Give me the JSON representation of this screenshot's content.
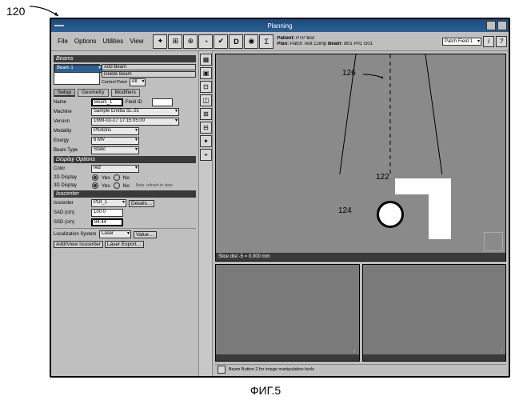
{
  "diagram": {
    "ref": "120",
    "caption": "ФИГ.5"
  },
  "window": {
    "title": "Planning"
  },
  "menu": {
    "file": "File",
    "options": "Options",
    "utilities": "Utilities",
    "view": "View"
  },
  "info": {
    "patientLabel": "Patient:",
    "patientValue": "PTP test",
    "planLabel": "Plan:",
    "planValue": "Patch Test Comp",
    "beamLabel": "Beam:",
    "beamValue": "B01 P01 G01"
  },
  "fieldSelector": {
    "value": "Patch Field 1"
  },
  "panels": {
    "beams": {
      "title": "Beams",
      "selected": "Beam 1",
      "addBeam": "Add Beam",
      "deleteBeam": "Delete Beam",
      "controlPoint": "Control Point",
      "ctrlDropdown": "All"
    },
    "tabs": {
      "setup": "Setup",
      "geometry": "Geometry",
      "modifiers": "Modifiers"
    },
    "setup": {
      "nameLabel": "Name",
      "nameValue": "Beam_1",
      "fieldIdLabel": "Field ID",
      "fieldIdValue": "",
      "machineLabel": "Machine",
      "machineValue": "Sample Emitta SL-25",
      "versionLabel": "Version",
      "versionValue": "1999-02-17 17:15:05:00",
      "modalityLabel": "Modality",
      "modalityValue": "Photons",
      "energyLabel": "Energy",
      "energyValue": "6 MV",
      "beamTypeLabel": "Beam Type",
      "beamTypeValue": "Static"
    },
    "display": {
      "title": "Display Options",
      "colorLabel": "Color",
      "colorValue": "red",
      "d2Label": "2D Display",
      "d3Label": "3D Display",
      "yes": "Yes",
      "no": "No",
      "note": "Note: refresh to view"
    },
    "iso": {
      "title": "Isocenter",
      "isoLabel": "Isocenter",
      "isoValue": "POI_1",
      "detailsBtn": "Details…",
      "sadLabel": "SAD (cm)",
      "sadValue": "100.0",
      "ssdLabel": "SSD (cm)",
      "ssdValue": "84.44",
      "locSysLabel": "Localization System",
      "locSysValue": "Laser",
      "valueBtn": "Value…",
      "addBtn": "Add/View Isocenter",
      "exportBtn": "Laser Export…"
    }
  },
  "mainview": {
    "footer": "Slice dist -5 = 0.000 mm"
  },
  "annotations": {
    "a126": "126",
    "a122": "122",
    "a124": "124"
  },
  "thumbs": {
    "t1foot": "",
    "t2foot": ""
  },
  "status": {
    "text": "Beam Button 2 for image manipulation tools"
  }
}
